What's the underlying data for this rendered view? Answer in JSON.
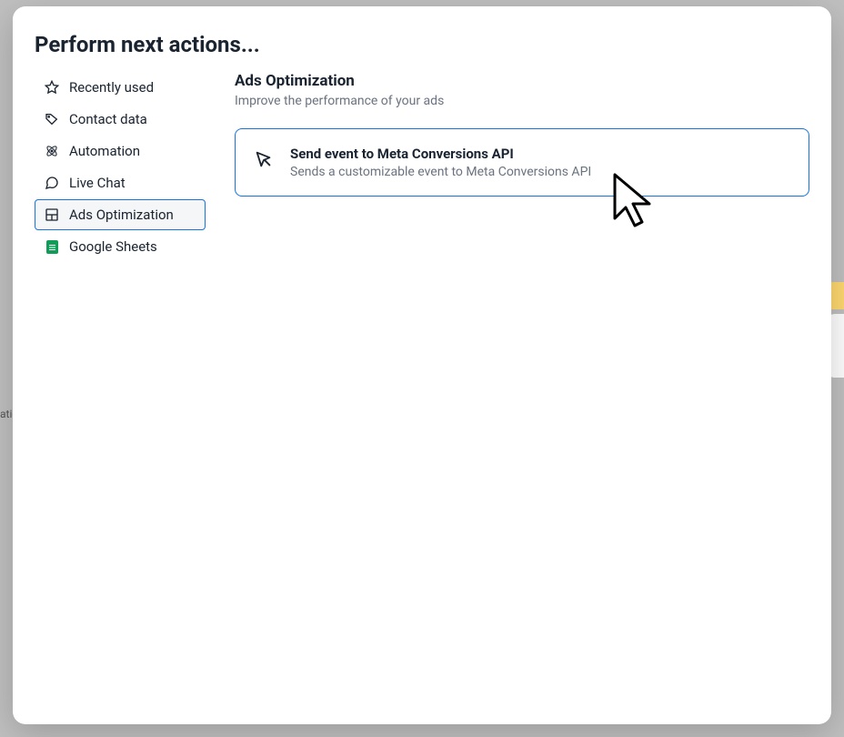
{
  "modal": {
    "title": "Perform next actions..."
  },
  "sidebar": {
    "items": [
      {
        "label": "Recently used",
        "icon": "star"
      },
      {
        "label": "Contact data",
        "icon": "tag"
      },
      {
        "label": "Automation",
        "icon": "atom"
      },
      {
        "label": "Live Chat",
        "icon": "chat"
      },
      {
        "label": "Ads Optimization",
        "icon": "layout"
      },
      {
        "label": "Google Sheets",
        "icon": "sheets"
      }
    ]
  },
  "main": {
    "section_title": "Ads Optimization",
    "section_subtitle": "Improve the performance of your ads",
    "actions": [
      {
        "title": "Send event to Meta Conversions API",
        "description": "Sends a customizable event to Meta Conversions API"
      }
    ]
  },
  "background": {
    "truncated_text": "atic"
  }
}
